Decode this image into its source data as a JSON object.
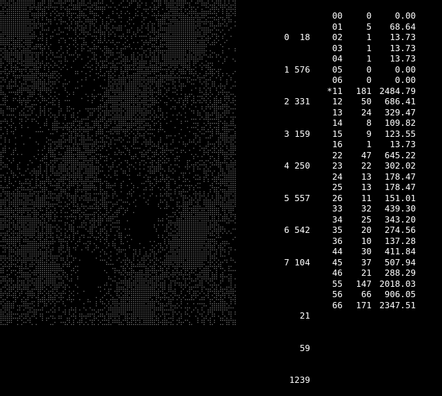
{
  "colors": {
    "background": "#000000",
    "text": "#ffffff",
    "dots": "#d8d8d8"
  },
  "dot_field": {
    "description_icon": "dither-dot-pattern-icon"
  },
  "state_table": [
    "0  18",
    "1 576",
    "2 331",
    "3 159",
    "4 250",
    "5 557",
    "6 542",
    "7 104"
  ],
  "totals": [
    "21",
    "59",
    "1239"
  ],
  "cell_table": [
    {
      "cell": "00",
      "count": "0",
      "value": "0.00"
    },
    {
      "cell": "01",
      "count": "5",
      "value": "68.64"
    },
    {
      "cell": "02",
      "count": "1",
      "value": "13.73"
    },
    {
      "cell": "03",
      "count": "1",
      "value": "13.73"
    },
    {
      "cell": "04",
      "count": "1",
      "value": "13.73"
    },
    {
      "cell": "05",
      "count": "0",
      "value": "0.00"
    },
    {
      "cell": "06",
      "count": "0",
      "value": "0.00"
    },
    {
      "cell": "*11",
      "count": "181",
      "value": "2484.79"
    },
    {
      "cell": "12",
      "count": "50",
      "value": "686.41"
    },
    {
      "cell": "13",
      "count": "24",
      "value": "329.47"
    },
    {
      "cell": "14",
      "count": "8",
      "value": "109.82"
    },
    {
      "cell": "15",
      "count": "9",
      "value": "123.55"
    },
    {
      "cell": "16",
      "count": "1",
      "value": "13.73"
    },
    {
      "cell": "22",
      "count": "47",
      "value": "645.22"
    },
    {
      "cell": "23",
      "count": "22",
      "value": "302.02"
    },
    {
      "cell": "24",
      "count": "13",
      "value": "178.47"
    },
    {
      "cell": "25",
      "count": "13",
      "value": "178.47"
    },
    {
      "cell": "26",
      "count": "11",
      "value": "151.01"
    },
    {
      "cell": "33",
      "count": "32",
      "value": "439.30"
    },
    {
      "cell": "34",
      "count": "25",
      "value": "343.20"
    },
    {
      "cell": "35",
      "count": "20",
      "value": "274.56"
    },
    {
      "cell": "36",
      "count": "10",
      "value": "137.28"
    },
    {
      "cell": "44",
      "count": "30",
      "value": "411.84"
    },
    {
      "cell": "45",
      "count": "37",
      "value": "507.94"
    },
    {
      "cell": "46",
      "count": "21",
      "value": "288.29"
    },
    {
      "cell": "55",
      "count": "147",
      "value": "2018.03"
    },
    {
      "cell": "56",
      "count": "66",
      "value": "906.05"
    },
    {
      "cell": "66",
      "count": "171",
      "value": "2347.51"
    }
  ]
}
